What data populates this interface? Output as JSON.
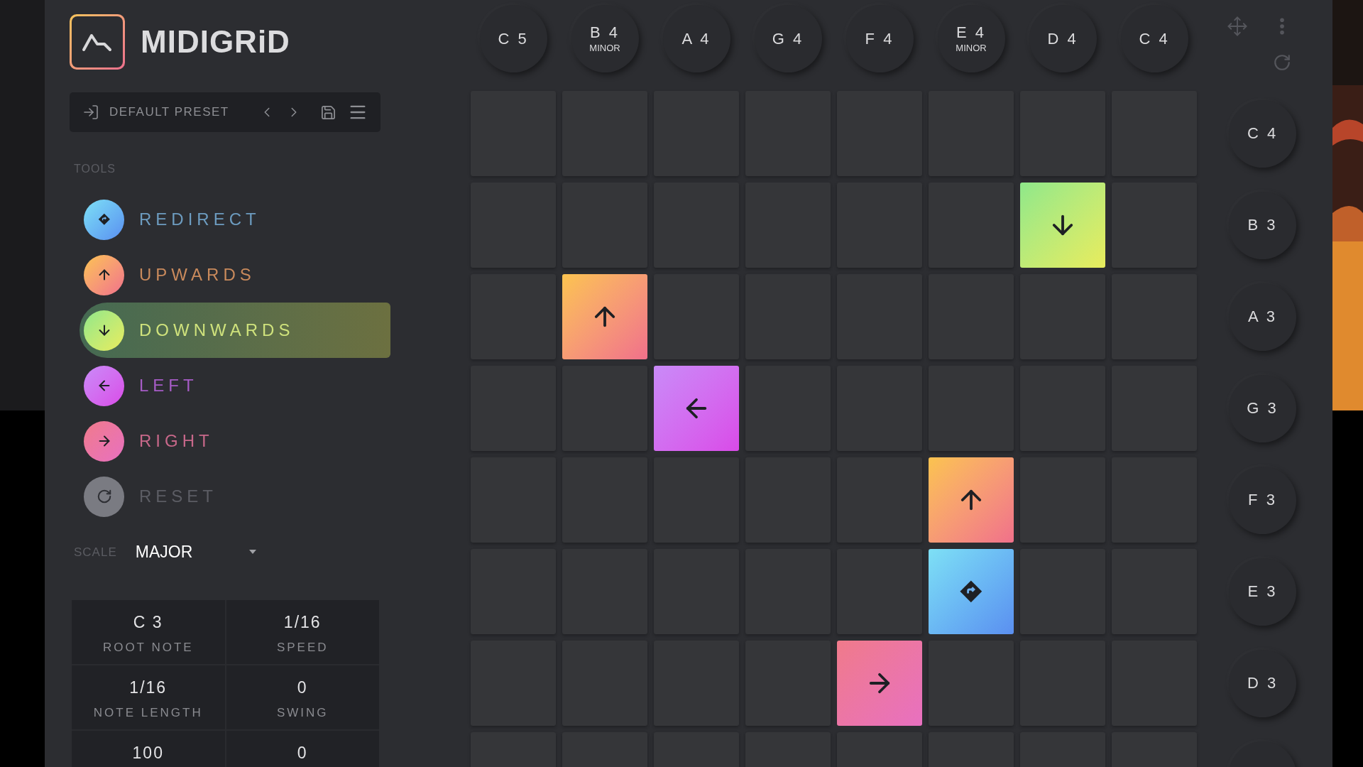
{
  "app": {
    "title": "MIDIGRiD"
  },
  "preset": {
    "name": "DEFAULT PRESET"
  },
  "tools_heading": "TOOLS",
  "tools": [
    {
      "label": "REDIRECT",
      "kind": "redirect",
      "selected": false
    },
    {
      "label": "UPWARDS",
      "kind": "up",
      "selected": false
    },
    {
      "label": "DOWNWARDS",
      "kind": "down",
      "selected": true
    },
    {
      "label": "LEFT",
      "kind": "left",
      "selected": false
    },
    {
      "label": "RIGHT",
      "kind": "right",
      "selected": false
    },
    {
      "label": "RESET",
      "kind": "reset",
      "selected": false
    }
  ],
  "scale": {
    "label": "SCALE",
    "value": "MAJOR"
  },
  "params": [
    {
      "value": "C 3",
      "label": "ROOT NOTE"
    },
    {
      "value": "1/16",
      "label": "SPEED"
    },
    {
      "value": "1/16",
      "label": "NOTE LENGTH"
    },
    {
      "value": "0",
      "label": "SWING"
    },
    {
      "value": "100"
    },
    {
      "value": "0"
    }
  ],
  "column_notes": [
    {
      "note": "C 5"
    },
    {
      "note": "B 4",
      "quality": "MINOR"
    },
    {
      "note": "A 4"
    },
    {
      "note": "G 4"
    },
    {
      "note": "F 4"
    },
    {
      "note": "E 4",
      "quality": "MINOR"
    },
    {
      "note": "D 4"
    },
    {
      "note": "C 4"
    }
  ],
  "row_notes": [
    "C 4",
    "B 3",
    "A 3",
    "G 3",
    "F 3",
    "E 3",
    "D 3"
  ],
  "grid": [
    {
      "cells": [
        {
          "kind": "empty"
        },
        {
          "kind": "empty"
        },
        {
          "kind": "empty"
        },
        {
          "kind": "empty"
        },
        {
          "kind": "empty"
        },
        {
          "kind": "empty"
        },
        {
          "kind": "empty"
        },
        {
          "kind": "empty"
        }
      ]
    },
    {
      "cells": [
        {
          "kind": "empty"
        },
        {
          "kind": "empty"
        },
        {
          "kind": "empty"
        },
        {
          "kind": "empty"
        },
        {
          "kind": "empty"
        },
        {
          "kind": "empty"
        },
        {
          "kind": "down"
        },
        {
          "kind": "empty"
        }
      ]
    },
    {
      "cells": [
        {
          "kind": "empty"
        },
        {
          "kind": "up"
        },
        {
          "kind": "empty"
        },
        {
          "kind": "empty"
        },
        {
          "kind": "empty"
        },
        {
          "kind": "empty"
        },
        {
          "kind": "empty"
        },
        {
          "kind": "empty"
        }
      ]
    },
    {
      "cells": [
        {
          "kind": "empty"
        },
        {
          "kind": "empty"
        },
        {
          "kind": "left"
        },
        {
          "kind": "empty"
        },
        {
          "kind": "empty"
        },
        {
          "kind": "empty"
        },
        {
          "kind": "empty"
        },
        {
          "kind": "empty"
        }
      ]
    },
    {
      "cells": [
        {
          "kind": "empty"
        },
        {
          "kind": "empty"
        },
        {
          "kind": "empty"
        },
        {
          "kind": "empty"
        },
        {
          "kind": "empty"
        },
        {
          "kind": "up"
        },
        {
          "kind": "empty"
        },
        {
          "kind": "empty"
        }
      ]
    },
    {
      "cells": [
        {
          "kind": "empty"
        },
        {
          "kind": "empty"
        },
        {
          "kind": "empty"
        },
        {
          "kind": "empty"
        },
        {
          "kind": "empty"
        },
        {
          "kind": "redirect"
        },
        {
          "kind": "empty"
        },
        {
          "kind": "empty"
        }
      ]
    },
    {
      "cells": [
        {
          "kind": "empty"
        },
        {
          "kind": "empty"
        },
        {
          "kind": "empty"
        },
        {
          "kind": "empty"
        },
        {
          "kind": "right"
        },
        {
          "kind": "empty"
        },
        {
          "kind": "empty"
        },
        {
          "kind": "empty"
        }
      ]
    },
    {
      "cells": [
        {
          "kind": "empty"
        },
        {
          "kind": "empty"
        },
        {
          "kind": "empty"
        },
        {
          "kind": "empty"
        },
        {
          "kind": "empty"
        },
        {
          "kind": "empty"
        },
        {
          "kind": "empty"
        },
        {
          "kind": "empty"
        }
      ]
    }
  ]
}
